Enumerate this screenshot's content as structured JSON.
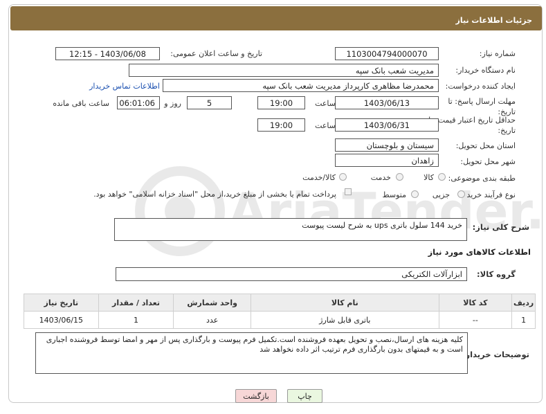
{
  "header": {
    "title": "جزئیات اطلاعات نیاز"
  },
  "labels": {
    "need_number": "شماره نیاز:",
    "announce_datetime": "تاریخ و ساعت اعلان عمومی:",
    "buyer_org": "نام دستگاه خریدار:",
    "creator": "ایجاد کننده درخواست:",
    "send_deadline": "مهلت ارسال پاسخ: تا تاریخ:",
    "validity_deadline": "حداقل تاریخ اعتبار قیمت: تا تاریخ:",
    "hour": "ساعت",
    "day_and": "روز و",
    "hours_remaining": "ساعت باقی مانده",
    "delivery_province": "استان محل تحویل:",
    "delivery_city": "شهر محل تحویل:",
    "category": "طبقه بندی موضوعی:",
    "purchase_type": "نوع فرآیند خرید :",
    "summary": "شرح کلی نیاز:",
    "goods_info": "اطلاعات کالاهای مورد نیاز",
    "goods_group": "گروه کالا:",
    "buyer_notes": "توضیحات خریدار:"
  },
  "fields": {
    "need_number": "1103004794000070",
    "announce_datetime": "1403/06/08 - 12:15",
    "buyer_org": "مدیریت شعب بانک سپه",
    "creator": "محمدرضا مظاهری کارپرداز مدیریت شعب بانک سپه",
    "contact_link": "اطلاعات تماس خریدار",
    "send_date": "1403/06/13",
    "send_time": "19:00",
    "days": "5",
    "remaining": "06:01:06",
    "validity_date": "1403/06/31",
    "validity_time": "19:00",
    "province": "سیستان و بلوچستان",
    "city": "زاهدان",
    "summary": "خرید 144 سلول باتری ups به شرح لیست پیوست",
    "goods_group": "ابزارآلات الکتریکی",
    "notes": "کلیه هزینه های ارسال،نصب و تحویل بعهده فروشنده است.تکمیل فرم پیوست و بارگذاری پس از مهر و امضا توسط فروشنده اجباری است و به قیمتهای بدون بارگذاری فرم ترتیب اثر داده نخواهد شد"
  },
  "category_options": [
    "کالا",
    "خدمت",
    "کالا/خدمت"
  ],
  "purchase_options": {
    "minor": "جزیی",
    "medium": "متوسط",
    "treasury_note": "پرداخت تمام یا بخشی از مبلغ خرید،از محل \"اسناد خزانه اسلامی\" خواهد بود."
  },
  "table": {
    "headers": [
      "ردیف",
      "کد کالا",
      "نام کالا",
      "واحد شمارش",
      "تعداد / مقدار",
      "تاریخ نیاز"
    ],
    "rows": [
      [
        "1",
        "--",
        "باتری قابل شارژ",
        "عدد",
        "1",
        "1403/06/15"
      ]
    ]
  },
  "buttons": {
    "print": "چاپ",
    "back": "بازگشت"
  },
  "watermark": "AriaTender.neT",
  "colors": {
    "header_bg": "#8b6f3e",
    "link": "#1a4fb0",
    "back_btn_bg": "#f7d7d7",
    "print_btn_bg": "#eaf7e0"
  }
}
